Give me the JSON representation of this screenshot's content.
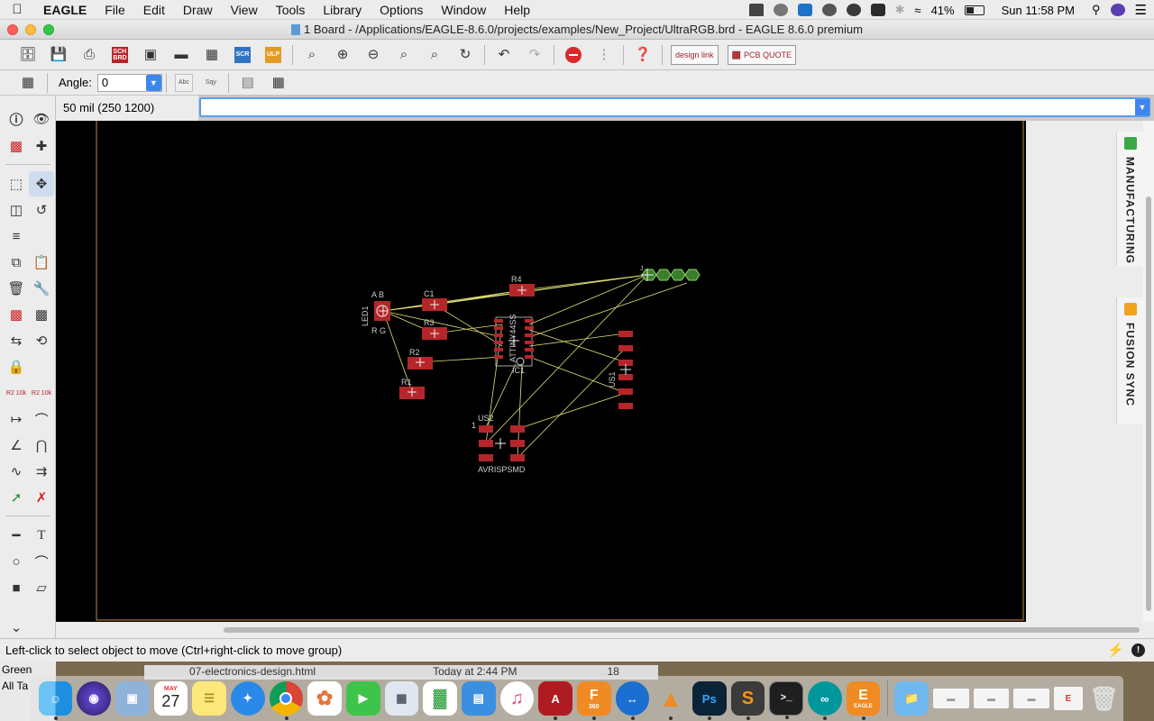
{
  "menubar": {
    "app_name": "EAGLE",
    "items": [
      "File",
      "Edit",
      "Draw",
      "View",
      "Tools",
      "Library",
      "Options",
      "Window",
      "Help"
    ],
    "battery": "41%",
    "clock": "Sun 11:58 PM"
  },
  "window": {
    "title": "1 Board - /Applications/EAGLE-8.6.0/projects/examples/New_Project/UltraRGB.brd - EAGLE 8.6.0 premium"
  },
  "toolbar": {
    "scr_label": "SCR",
    "ulp_label": "ULP",
    "designlink_label": "design link",
    "pcbquote_label": "PCB QUOTE"
  },
  "parameters": {
    "angle_label": "Angle:",
    "angle_value": "0",
    "text_toggle_label": "Abc",
    "text_toggle2_label": "Sqy"
  },
  "command": {
    "coordinates": "50 mil (250 1200)",
    "value": ""
  },
  "palette": {
    "resistor_label_a": "R2 10k",
    "resistor_label_b": "R2 10k"
  },
  "board": {
    "led_label": "LED1",
    "led_pins_top": "A B",
    "led_pins_bottom": "R G",
    "c1": "C1",
    "r1": "R1",
    "r2": "R2",
    "r3": "R3",
    "r4": "R4",
    "ic_label": "IC1",
    "ic_name": "ATTINY44SS",
    "jp_label": "J",
    "us1_label": "US1",
    "us2_label": "US2",
    "us2_pin": "1",
    "avrisp_label": "AVRISPSMD"
  },
  "rightpanel": {
    "tab1": "MANUFACTURING",
    "tab2": "FUSION SYNC"
  },
  "status": {
    "message": "Left-click to select object to move (Ctrl+right-click to move group)"
  },
  "background_window": {
    "sidebar_item1": "Green",
    "sidebar_item2": "All Ta",
    "file_name": "07-electronics-design.html",
    "file_date": "Today at 2:44 PM",
    "file_size": "18"
  },
  "dock": {
    "calendar_month": "MAY",
    "calendar_day": "27",
    "fusion_label": "360",
    "eagle_label": "EAGLE"
  },
  "colors": {
    "canvas": "#000000",
    "pad": "#b5262a",
    "airwire": "#e2e277",
    "outline": "#c88a3c",
    "accent": "#3d86f2"
  }
}
